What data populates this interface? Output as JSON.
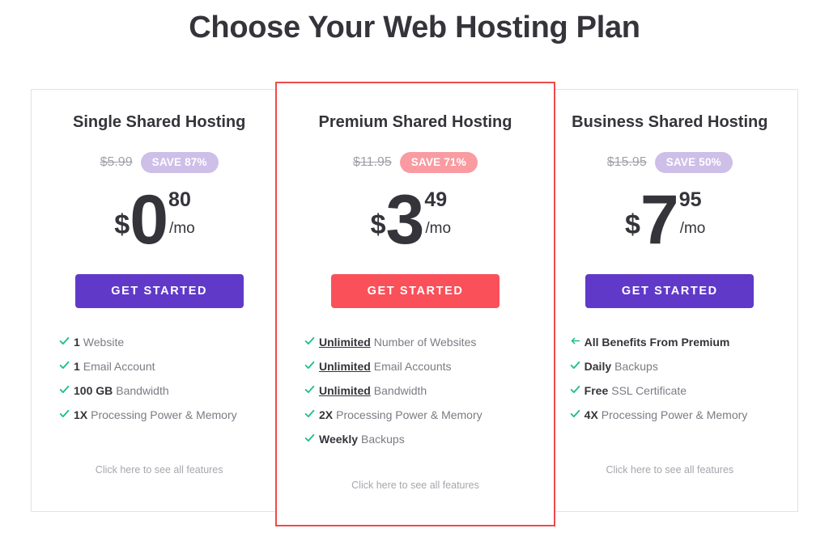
{
  "page": {
    "title": "Choose Your Web Hosting Plan"
  },
  "colors": {
    "purple": "#5f3dc4",
    "purple_button": "#6039c9",
    "coral": "#f9505a",
    "badge_purple_bg": "#cdbfe8",
    "badge_coral_bg": "#f99ba1",
    "check_green": "#1bbf83",
    "highlight_border": "#ef4b4b",
    "container_border": "#e3e3e5",
    "title_text": "#34343a",
    "muted_text": "#7b7b84",
    "old_price": "#a0a0a8"
  },
  "plans": [
    {
      "id": "single-shared-hosting",
      "title": "Single Shared Hosting",
      "old_price": "$5.99",
      "save_badge": "SAVE 87%",
      "currency": "$",
      "amount": "0",
      "cents": "80",
      "period": "/mo",
      "cta_label": "GET STARTED",
      "all_features_label": "Click here to see all features",
      "features": [
        {
          "icon": "check-icon",
          "strong": "1",
          "underline": false,
          "rest": "Website",
          "all_bold": false
        },
        {
          "icon": "check-icon",
          "strong": "1",
          "underline": false,
          "rest": "Email Account",
          "all_bold": false
        },
        {
          "icon": "check-icon",
          "strong": "100 GB",
          "underline": false,
          "rest": "Bandwidth",
          "all_bold": false
        },
        {
          "icon": "check-icon",
          "strong": "1X",
          "underline": false,
          "rest": "Processing Power & Memory",
          "all_bold": false
        }
      ]
    },
    {
      "id": "premium-shared-hosting",
      "title": "Premium Shared Hosting",
      "old_price": "$11.95",
      "save_badge": "SAVE 71%",
      "currency": "$",
      "amount": "3",
      "cents": "49",
      "period": "/mo",
      "cta_label": "GET STARTED",
      "all_features_label": "Click here to see all features",
      "features": [
        {
          "icon": "check-icon",
          "strong": "Unlimited",
          "underline": true,
          "rest": "Number of Websites",
          "all_bold": false
        },
        {
          "icon": "check-icon",
          "strong": "Unlimited",
          "underline": true,
          "rest": "Email Accounts",
          "all_bold": false
        },
        {
          "icon": "check-icon",
          "strong": "Unlimited",
          "underline": true,
          "rest": "Bandwidth",
          "all_bold": false
        },
        {
          "icon": "check-icon",
          "strong": "2X",
          "underline": false,
          "rest": "Processing Power & Memory",
          "all_bold": false
        },
        {
          "icon": "check-icon",
          "strong": "Weekly",
          "underline": false,
          "rest": "Backups",
          "all_bold": false
        }
      ]
    },
    {
      "id": "business-shared-hosting",
      "title": "Business Shared Hosting",
      "old_price": "$15.95",
      "save_badge": "SAVE 50%",
      "currency": "$",
      "amount": "7",
      "cents": "95",
      "period": "/mo",
      "cta_label": "GET STARTED",
      "all_features_label": "Click here to see all features",
      "features": [
        {
          "icon": "arrow-left-icon",
          "strong": "",
          "underline": false,
          "rest": "All Benefits From Premium",
          "all_bold": true
        },
        {
          "icon": "check-icon",
          "strong": "Daily",
          "underline": false,
          "rest": "Backups",
          "all_bold": false
        },
        {
          "icon": "check-icon",
          "strong": "Free",
          "underline": false,
          "rest": "SSL Certificate",
          "all_bold": false
        },
        {
          "icon": "check-icon",
          "strong": "4X",
          "underline": false,
          "rest": "Processing Power & Memory",
          "all_bold": false
        }
      ]
    }
  ]
}
